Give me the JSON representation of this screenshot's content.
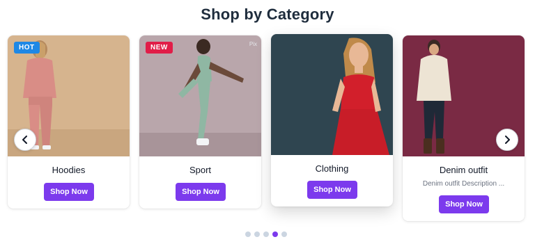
{
  "section": {
    "title": "Shop by Category"
  },
  "cards": [
    {
      "title": "Hoodies",
      "badge": "HOT",
      "badge_color": "#1e88e5",
      "button": "Shop Now"
    },
    {
      "title": "Sport",
      "badge": "NEW",
      "badge_color": "#e11d48",
      "watermark": "Pix",
      "button": "Shop Now"
    },
    {
      "title": "Clothing",
      "button": "Shop Now"
    },
    {
      "title": "Denim outfit",
      "description": "Denim outfit Description ...",
      "button": "Shop Now"
    }
  ],
  "carousel": {
    "active_slide": 4,
    "total_slides": 5
  },
  "colors": {
    "accent": "#7c3aed",
    "dot_inactive": "#cbd5e1"
  }
}
